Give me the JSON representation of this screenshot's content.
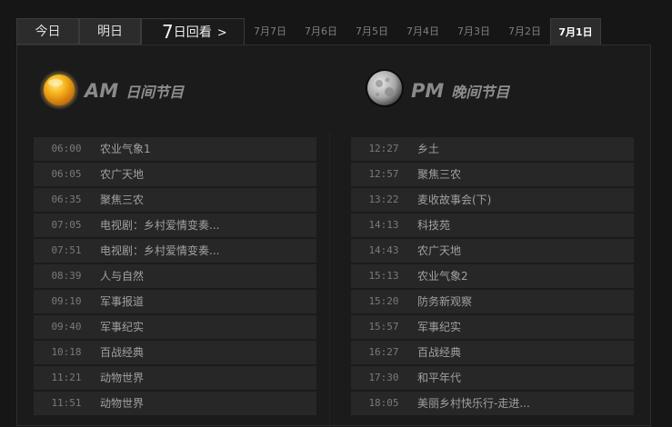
{
  "tabs": {
    "today": "今日",
    "tomorrow": "明日",
    "replay_num": "7",
    "replay_text": "日回看",
    "replay_chevron": ">"
  },
  "dates": [
    "7月7日",
    "7月6日",
    "7月5日",
    "7月4日",
    "7月3日",
    "7月2日",
    "7月1日"
  ],
  "active_date_index": 6,
  "am": {
    "label": "AM",
    "title": "日间节目",
    "programs": [
      {
        "time": "06:00",
        "title": "农业气象1"
      },
      {
        "time": "06:05",
        "title": "农广天地"
      },
      {
        "time": "06:35",
        "title": "聚焦三农"
      },
      {
        "time": "07:05",
        "title": "电视剧：乡村爱情变奏..."
      },
      {
        "time": "07:51",
        "title": "电视剧：乡村爱情变奏..."
      },
      {
        "time": "08:39",
        "title": "人与自然"
      },
      {
        "time": "09:10",
        "title": "军事报道"
      },
      {
        "time": "09:40",
        "title": "军事纪实"
      },
      {
        "time": "10:18",
        "title": "百战经典"
      },
      {
        "time": "11:21",
        "title": "动物世界"
      },
      {
        "time": "11:51",
        "title": "动物世界"
      }
    ]
  },
  "pm": {
    "label": "PM",
    "title": "晚间节目",
    "programs": [
      {
        "time": "12:27",
        "title": "乡土"
      },
      {
        "time": "12:57",
        "title": "聚焦三农"
      },
      {
        "time": "13:22",
        "title": "麦收故事会(下)"
      },
      {
        "time": "14:13",
        "title": "科技苑"
      },
      {
        "time": "14:43",
        "title": "农广天地"
      },
      {
        "time": "15:13",
        "title": "农业气象2"
      },
      {
        "time": "15:20",
        "title": "防务新观察"
      },
      {
        "time": "15:57",
        "title": "军事纪实"
      },
      {
        "time": "16:27",
        "title": "百战经典"
      },
      {
        "time": "17:30",
        "title": "和平年代"
      },
      {
        "time": "18:05",
        "title": "美丽乡村快乐行-走进..."
      }
    ]
  }
}
